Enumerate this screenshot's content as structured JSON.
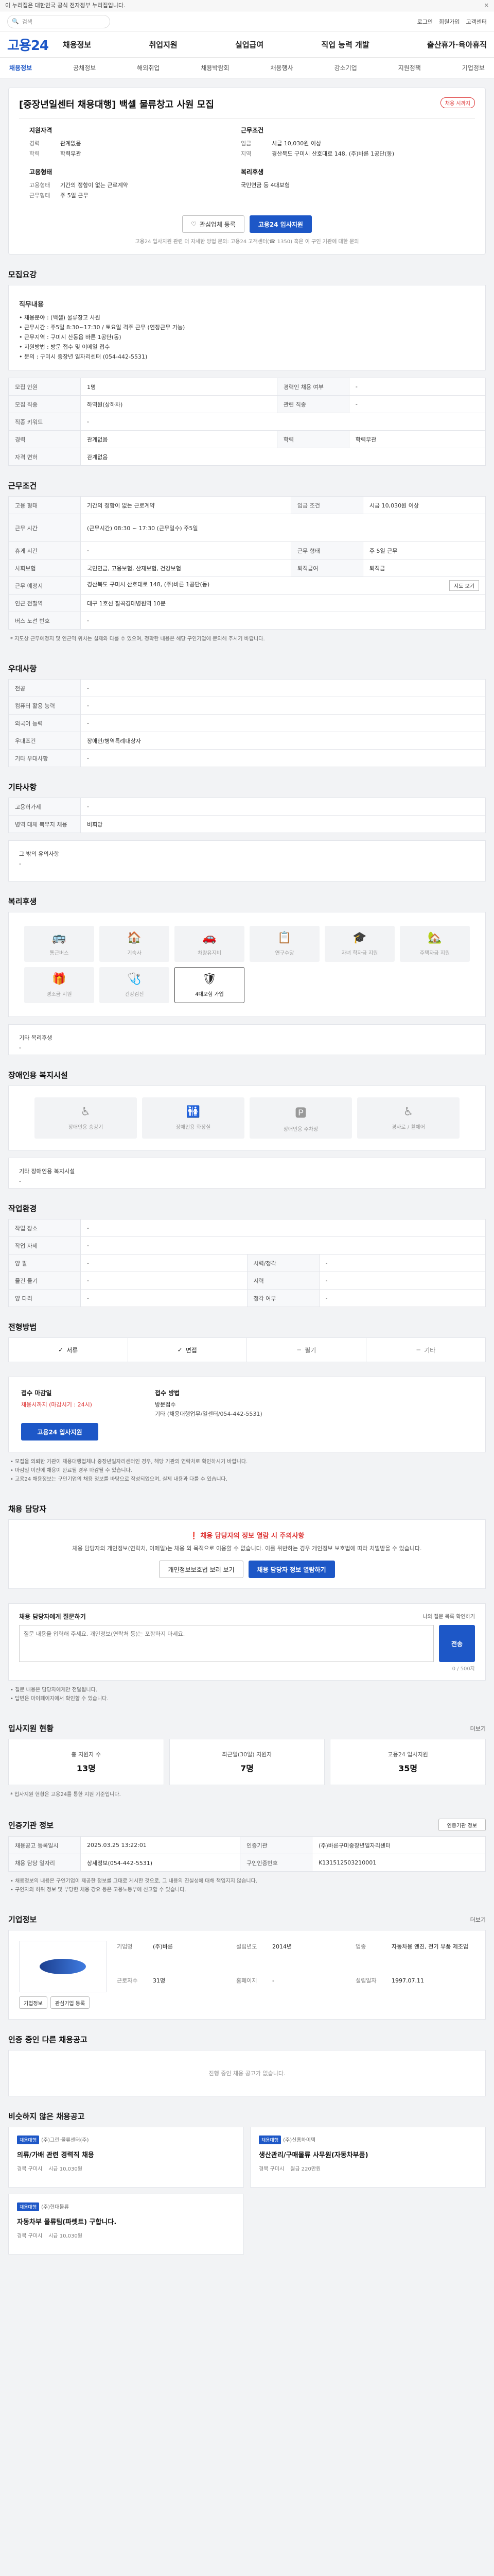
{
  "gov_banner": {
    "text": "이 누리집은 대한민국 공식 전자정부 누리집입니다.",
    "close": "✕"
  },
  "top": {
    "search_placeholder": "검색",
    "links": [
      "로그인",
      "회원가입",
      "고객센터"
    ]
  },
  "logo": "고용24",
  "gnb": [
    "채용정보",
    "취업지원",
    "실업급여",
    "직업 능력 개발",
    "출산휴가·육아휴직"
  ],
  "subnav": {
    "items": [
      "채용정보",
      "공채정보",
      "해외취업",
      "채용박람회",
      "채용행사",
      "강소기업",
      "지원정책",
      "기업정보"
    ],
    "active": 0
  },
  "job": {
    "title": "[중장년일센터 채용대행] 백셀 물류창고 사원 모집",
    "badge": "채용 시까지",
    "left_h": "지원자격",
    "career_k": "경력",
    "career_v": "관계없음",
    "edu_k": "학력",
    "edu_v": "학력무관",
    "right_h": "근무조건",
    "pay_k": "임금",
    "pay_v": "시급 10,030원 이상",
    "region_k": "지역",
    "region_v": "경산북도 구미시 산호대로 148, (주)바른 1공단(동)",
    "type_h": "고용형태",
    "type1_k": "고용형태",
    "type1_v": "기간의 정함이 없는 근로계약",
    "type2_k": "근무형태",
    "type2_v": "주 5일 근무",
    "welfare_h": "복리후생",
    "welfare_v": "국민연금 등 4대보험",
    "btn_favorite": "관심업체 등록",
    "btn_apply": "고용24 입사지원",
    "btn_note": "고용24 입사지원 관련 더 자세한 방법 문의: 고용24 고객센터(☎ 1350) 혹은 이 구인 기관에 대한 문의"
  },
  "recruit": {
    "title": "모집요강",
    "sub": "직무내용",
    "content": [
      "• 채용분야 : (백셀) 물류창고 사원",
      "• 근무시간 : 주5일 8:30~17:30 / 토요일 격주 근무 (연장근무 가능)",
      "• 근무지역 : 구미시 산동읍 바른 1공단(동)",
      "• 지원방법 : 방문 접수 및 이메일 접수",
      "• 문의 : 구미시 중장년 일자리센터 (054-442-5531)"
    ],
    "rows": [
      {
        "k1": "모집 인원",
        "v1": "1명",
        "k2": "경력인 채용 여부",
        "v2": "-"
      },
      {
        "k1": "모집 직종",
        "v1": "하역원(상하차)",
        "k2": "관련 직종",
        "v2": "-"
      },
      {
        "k1": "직종 키워드",
        "v1": "-",
        "k2": "",
        "v2": ""
      },
      {
        "k1": "경력",
        "v1": "관계없음",
        "k2": "학력",
        "v2": "학력무관"
      },
      {
        "k1": "자격 면허",
        "v1": "관계없음",
        "k2": "",
        "v2": ""
      }
    ]
  },
  "conditions": {
    "title": "근무조건",
    "rows": [
      {
        "k1": "고용 형태",
        "v1": "기간의 정함이 없는 근로계약",
        "k2": "임금 조건",
        "v2": "시급 10,030원 이상"
      },
      {
        "k1": "근무 시간",
        "v1": "(근무시간) 08:30 ~ 17:30 (근무일수) 주5일",
        "k2": "",
        "v2": ""
      },
      {
        "k1": "휴게 시간",
        "v1": "-",
        "k2": "근무 형태",
        "v2": "주 5일 근무"
      },
      {
        "k1": "사회보험",
        "v1": "국민연금, 고용보험, 산재보험, 건강보험",
        "k2": "퇴직급여",
        "v2": "퇴직금"
      },
      {
        "k1": "근무 예정지",
        "v1": "경산북도 구미시 산호대로 148, (주)바른 1공단(동)",
        "k2": "",
        "v2": "지도 보기"
      },
      {
        "k1": "인근 전철역",
        "v1": "대구 1호선 칠곡경대병원역 10분",
        "k2": "",
        "v2": ""
      },
      {
        "k1": "버스 노선 번호",
        "v1": "-",
        "k2": "",
        "v2": ""
      }
    ],
    "note": "* 지도상 근무예정지 및 인근역 위치는 실제와 다를 수 있으며, 정확한 내용은 해당 구인기업에 문의해 주시기 바랍니다."
  },
  "preferred": {
    "title": "우대사항",
    "rows": [
      {
        "k": "전공",
        "v": "-"
      },
      {
        "k": "컴퓨터 활용 능력",
        "v": "-"
      },
      {
        "k": "외국어 능력",
        "v": "-"
      },
      {
        "k": "우대조건",
        "v": "장애인/병역특례대상자"
      },
      {
        "k": "기타 우대사항",
        "v": "-"
      }
    ]
  },
  "other": {
    "title": "기타사항",
    "rows": [
      {
        "k": "고용허가제",
        "v": "-"
      },
      {
        "k": "병역 대체 복무지 채용",
        "v": "비희망"
      }
    ],
    "extra_k": "그 밖의 유의사항",
    "extra_v": "-"
  },
  "welfare": {
    "title": "복리후생",
    "items": [
      {
        "label": "통근버스",
        "icon": "bus-icon",
        "glyph": "🚌",
        "on": false
      },
      {
        "label": "기숙사",
        "icon": "dorm-icon",
        "glyph": "🏠",
        "on": false
      },
      {
        "label": "차량유지비",
        "icon": "car-icon",
        "glyph": "🚗",
        "on": false
      },
      {
        "label": "연구수당",
        "icon": "research-icon",
        "glyph": "📋",
        "on": false
      },
      {
        "label": "자녀 학자금 지원",
        "icon": "education-icon",
        "glyph": "🎓",
        "on": false
      },
      {
        "label": "주택자금 지원",
        "icon": "house-icon",
        "glyph": "🏡",
        "on": false
      },
      {
        "label": "경조금 지원",
        "icon": "gift-icon",
        "glyph": "🎁",
        "on": false
      },
      {
        "label": "건강검진",
        "icon": "health-icon",
        "glyph": "🩺",
        "on": false
      },
      {
        "label": "4대보험 가입",
        "icon": "insurance-icon",
        "glyph": "🛡",
        "on": true
      }
    ],
    "extra_k": "기타 복리후생",
    "extra_v": "-"
  },
  "disability": {
    "title": "장애인용 복지시설",
    "items": [
      {
        "label": "장애인용 승강기",
        "icon": "elevator-icon",
        "glyph": "♿"
      },
      {
        "label": "장애인용 화장실",
        "icon": "restroom-icon",
        "glyph": "🚻"
      },
      {
        "label": "장애인용 주차장",
        "icon": "parking-icon",
        "glyph": "🅿"
      },
      {
        "label": "경사로 / 휠체어",
        "icon": "ramp-icon",
        "glyph": "♿"
      }
    ],
    "extra_k": "기타 장애인용 복지시설",
    "extra_v": "-"
  },
  "env": {
    "title": "작업환경",
    "rows": [
      {
        "k1": "작업 장소",
        "v1": "-",
        "k2": "",
        "v2": ""
      },
      {
        "k1": "작업 자세",
        "v1": "-",
        "k2": "",
        "v2": ""
      },
      {
        "k1": "양 팔",
        "v1": "-",
        "k2": "시력/청각",
        "v2": "-"
      },
      {
        "k1": "물건 들기",
        "v1": "-",
        "k2": "시력",
        "v2": "-"
      },
      {
        "k1": "양 다리",
        "v1": "-",
        "k2": "청각 여부",
        "v2": "-"
      }
    ]
  },
  "process": {
    "title": "전형방법",
    "tabs": [
      "서류",
      "면접",
      "필기",
      "기타"
    ],
    "active": [
      true,
      true,
      false,
      false
    ]
  },
  "apply": {
    "deadline_h": "접수 마감일",
    "deadline_v": "채용시까지 (마감시기 : 24시)",
    "apply_h": "접수 방법",
    "apply_v1": "방문접수",
    "apply_v2": "기타 (채용대행업무/일센터/054-442-5531)",
    "btn": "고용24 입사지원",
    "notes": [
      "• 모집을 의뢰한 기관이 채용대행업체나 중장년일자리센터인 경우, 해당 기관의 연락처로 확인하시기 바랍니다.",
      "• 마감일 이전에 채용이 완료될 경우 마감될 수 있습니다.",
      "• 고용24 채용정보는 구인기업의 채용 정보를 바탕으로 작성되었으며, 실제 내용과 다를 수 있습니다."
    ]
  },
  "manager": {
    "title": "채용 담당자",
    "warn_t": "채용 담당자의 정보 열람 시 주의사항",
    "warn_p": "채용 담당자의 개인정보(연락처, 이메일)는 채용 외 목적으로 이용할 수 없습니다. 이를 위반하는 경우 개인정보 보호법에 따라 처벌받을 수 있습니다.",
    "btn1": "개인정보보호법 보러 보기",
    "btn2": "채용 담당자 정보 열람하기"
  },
  "question": {
    "title": "채용 담당자에게 질문하기",
    "link": "나의 질문 목록 확인하기",
    "placeholder": "질문 내용을 입력해 주세요. 개인정보(연락처 등)는 포함하지 마세요.",
    "send": "전송",
    "count": "0 / 500자",
    "notes": [
      "• 질문 내용은 담당자에게만 전달됩니다.",
      "• 답변은 마이페이지에서 확인할 수 있습니다."
    ]
  },
  "stats": {
    "title": "입사지원 현황",
    "more": "더보기",
    "items": [
      {
        "label": "총 지원자 수",
        "value": "13명"
      },
      {
        "label": "최근일(30일) 지원자",
        "value": "7명"
      },
      {
        "label": "고용24 입사지원",
        "value": "35명"
      }
    ],
    "note": "* 입사지원 현황은 고용24를 통한 지원 기준입니다."
  },
  "info": {
    "title": "인증기관 정보",
    "btn": "인증기관 정보",
    "rows": [
      {
        "k1": "채용공고 등록일시",
        "v1": "2025.03.25 13:22:01",
        "k2": "인증기관",
        "v2": "(주)바른구미중장년일자리센터"
      },
      {
        "k1": "채용 담당 일자리",
        "v1": "상세정보(054-442-5531)",
        "k2": "구인인증번호",
        "v2": "K131512503210001"
      }
    ],
    "notes": [
      "• 채용정보의 내용은 구인기업이 제공한 정보를 그대로 게시한 것으로, 그 내용의 진실성에 대해 책임지지 않습니다.",
      "• 구인자의 허위 정보 및 부당한 채용 강요 등은 고용노동부에 신고할 수 있습니다."
    ]
  },
  "company": {
    "title": "기업정보",
    "more": "더보기",
    "name": "(주)바른",
    "fields": [
      {
        "k": "기업명",
        "v": "(주)바른"
      },
      {
        "k": "설립년도",
        "v": "2014년"
      },
      {
        "k": "업종",
        "v": "자동차용 엔진, 전기 부품 제조업"
      },
      {
        "k": "근로자수",
        "v": "31명"
      },
      {
        "k": "홈페이지",
        "v": "-"
      },
      {
        "k": "설립일자",
        "v": "1997.07.11"
      }
    ],
    "btn1": "기업정보",
    "btn2": "관심기업 등록"
  },
  "other_jobs": {
    "title": "인증 중인 다른 채용공고",
    "empty": "진행 중인 채용 공고가 없습니다."
  },
  "similar": {
    "title": "비슷하지 않은 채용공고",
    "items": [
      {
        "tag": "채용대행",
        "company": "(주)그린·물류센터(주)",
        "title": "의류/가배 관련 경력직 채용",
        "loc": "경북 구미시",
        "pay": "시급 10,030원"
      },
      {
        "tag": "채용대행",
        "company": "(주)신흥하이텍",
        "title": "생산관리/구매물류 사무원(자동차부품)",
        "loc": "경북 구미시",
        "pay": "월급 220만원"
      },
      {
        "tag": "채용대행",
        "company": "(주)현대물류",
        "title": "자동차부 물류팀(파렛트) 구합니다.",
        "loc": "경북 구미시",
        "pay": "시급 10,030원"
      }
    ]
  }
}
